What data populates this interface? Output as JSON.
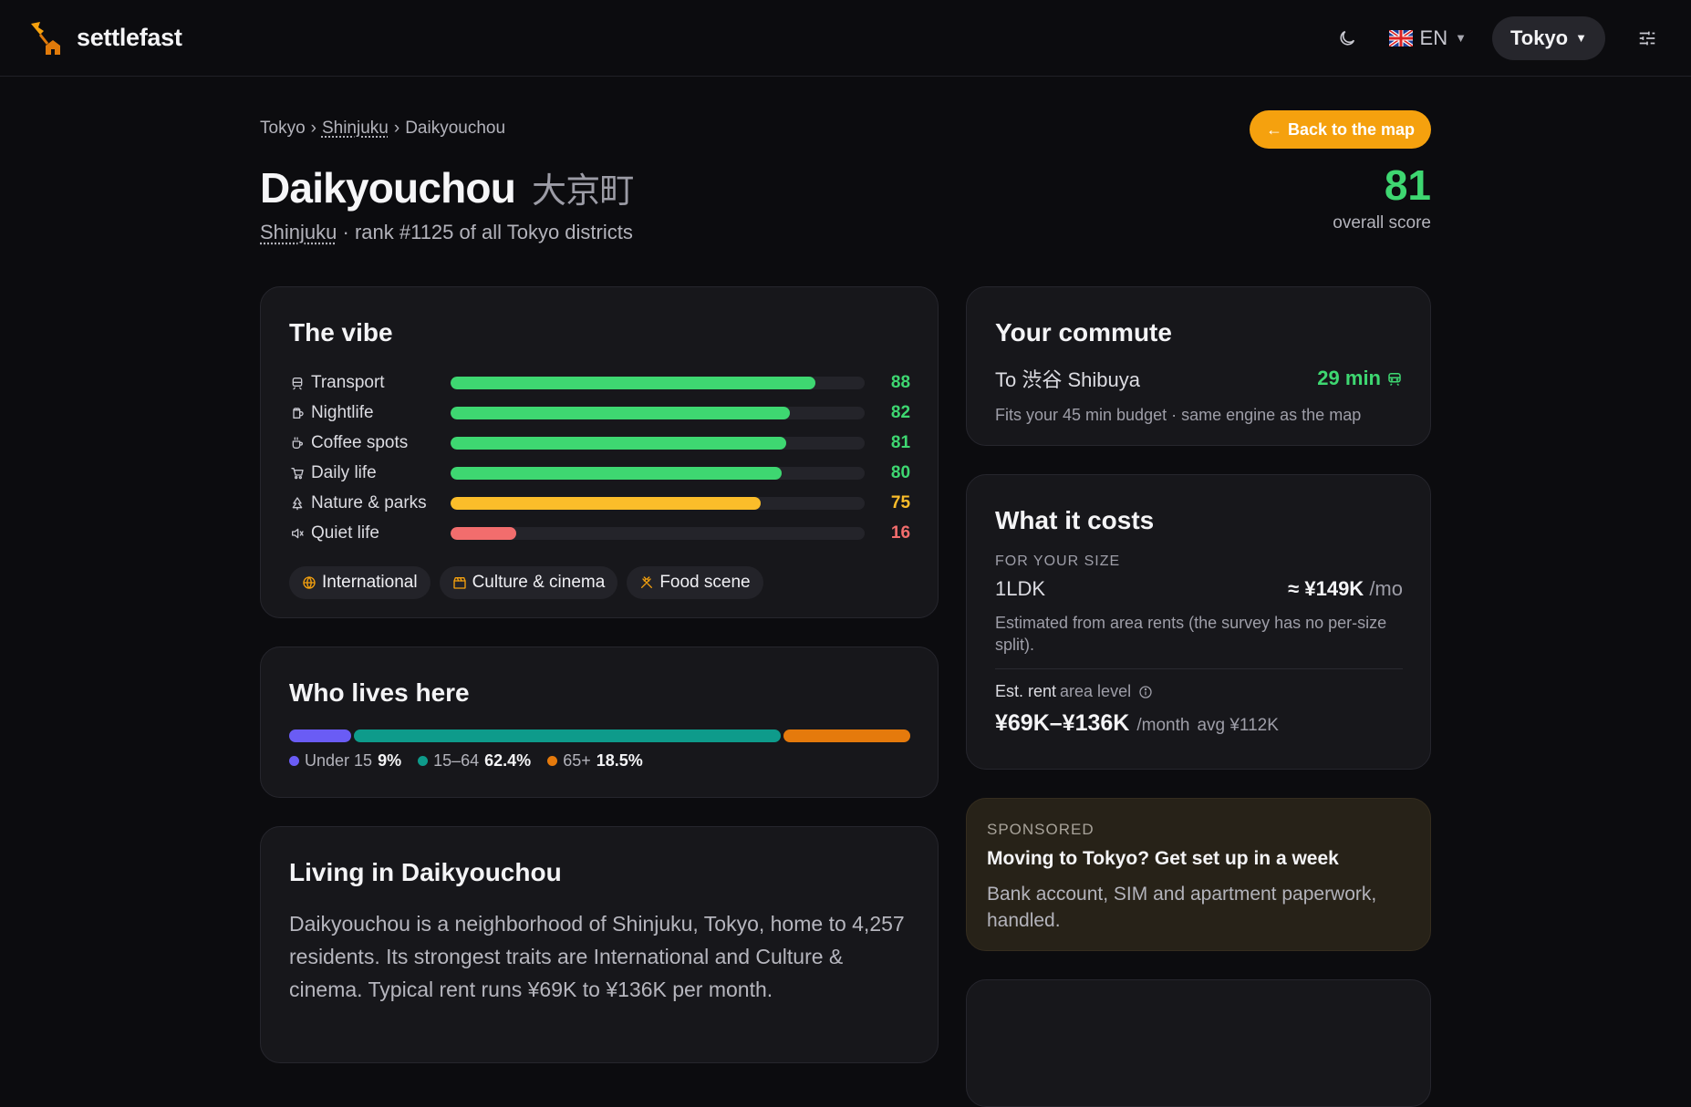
{
  "brand": {
    "name": "settlefast"
  },
  "topbar": {
    "theme_icon": "moon-icon",
    "language": "EN",
    "city": "Tokyo",
    "settings_icon": "sliders-icon"
  },
  "breadcrumb": {
    "city": "Tokyo",
    "ward": "Shinjuku",
    "district": "Daikyouchou"
  },
  "back_button": "Back to the map",
  "district": {
    "name": "Daikyouchou",
    "name_jp": "大京町",
    "ward": "Shinjuku",
    "rank_text": "· rank #1125 of all Tokyo districts",
    "score": "81",
    "score_label": "overall score"
  },
  "vibe": {
    "title": "The vibe",
    "rows": [
      {
        "label": "Transport",
        "score": 88,
        "color": "#3ed771",
        "icon": "train-icon"
      },
      {
        "label": "Nightlife",
        "score": 82,
        "color": "#3ed771",
        "icon": "beer-icon"
      },
      {
        "label": "Coffee spots",
        "score": 81,
        "color": "#3ed771",
        "icon": "coffee-icon"
      },
      {
        "label": "Daily life",
        "score": 80,
        "color": "#3ed771",
        "icon": "cart-icon"
      },
      {
        "label": "Nature & parks",
        "score": 75,
        "color": "#fbbd2a",
        "icon": "tree-icon"
      },
      {
        "label": "Quiet life",
        "score": 16,
        "color": "#f26d6d",
        "icon": "mute-icon"
      }
    ],
    "tags": [
      {
        "label": "International",
        "icon": "globe-icon"
      },
      {
        "label": "Culture & cinema",
        "icon": "clapper-icon"
      },
      {
        "label": "Food scene",
        "icon": "utensils-icon"
      }
    ]
  },
  "who": {
    "title": "Who lives here",
    "groups": [
      {
        "label": "Under 15",
        "value": "9%",
        "share": 9,
        "color": "#6a5cf5"
      },
      {
        "label": "15–64",
        "value": "62.4%",
        "share": 62.4,
        "color": "#0e9b8b"
      },
      {
        "label": "65+",
        "value": "18.5%",
        "share": 18.5,
        "color": "#e57a0c"
      }
    ]
  },
  "living": {
    "title": "Living in Daikyouchou",
    "text": "Daikyouchou is a neighborhood of Shinjuku, Tokyo, home to 4,257 residents. Its strongest traits are International and Culture & cinema. Typical rent runs ¥69K to ¥136K per month."
  },
  "commute": {
    "title": "Your commute",
    "destination": "To 渋谷 Shibuya",
    "time": "29 min",
    "note": "Fits your 45 min budget · same engine as the map"
  },
  "costs": {
    "title": "What it costs",
    "size_heading": "FOR YOUR SIZE",
    "size": "1LDK",
    "size_price": "≈ ¥149K",
    "size_unit": "/mo",
    "note": "Estimated from area rents (the survey has no per-size split).",
    "rent_label": "Est. rent",
    "rent_level": "area level",
    "rent_range": "¥69K–¥136K",
    "rent_unit": "/month",
    "rent_avg": "avg ¥112K"
  },
  "sponsored": {
    "label": "SPONSORED",
    "title": "Moving to Tokyo? Get set up in a week",
    "body": "Bank account, SIM and apartment paperwork, handled."
  }
}
